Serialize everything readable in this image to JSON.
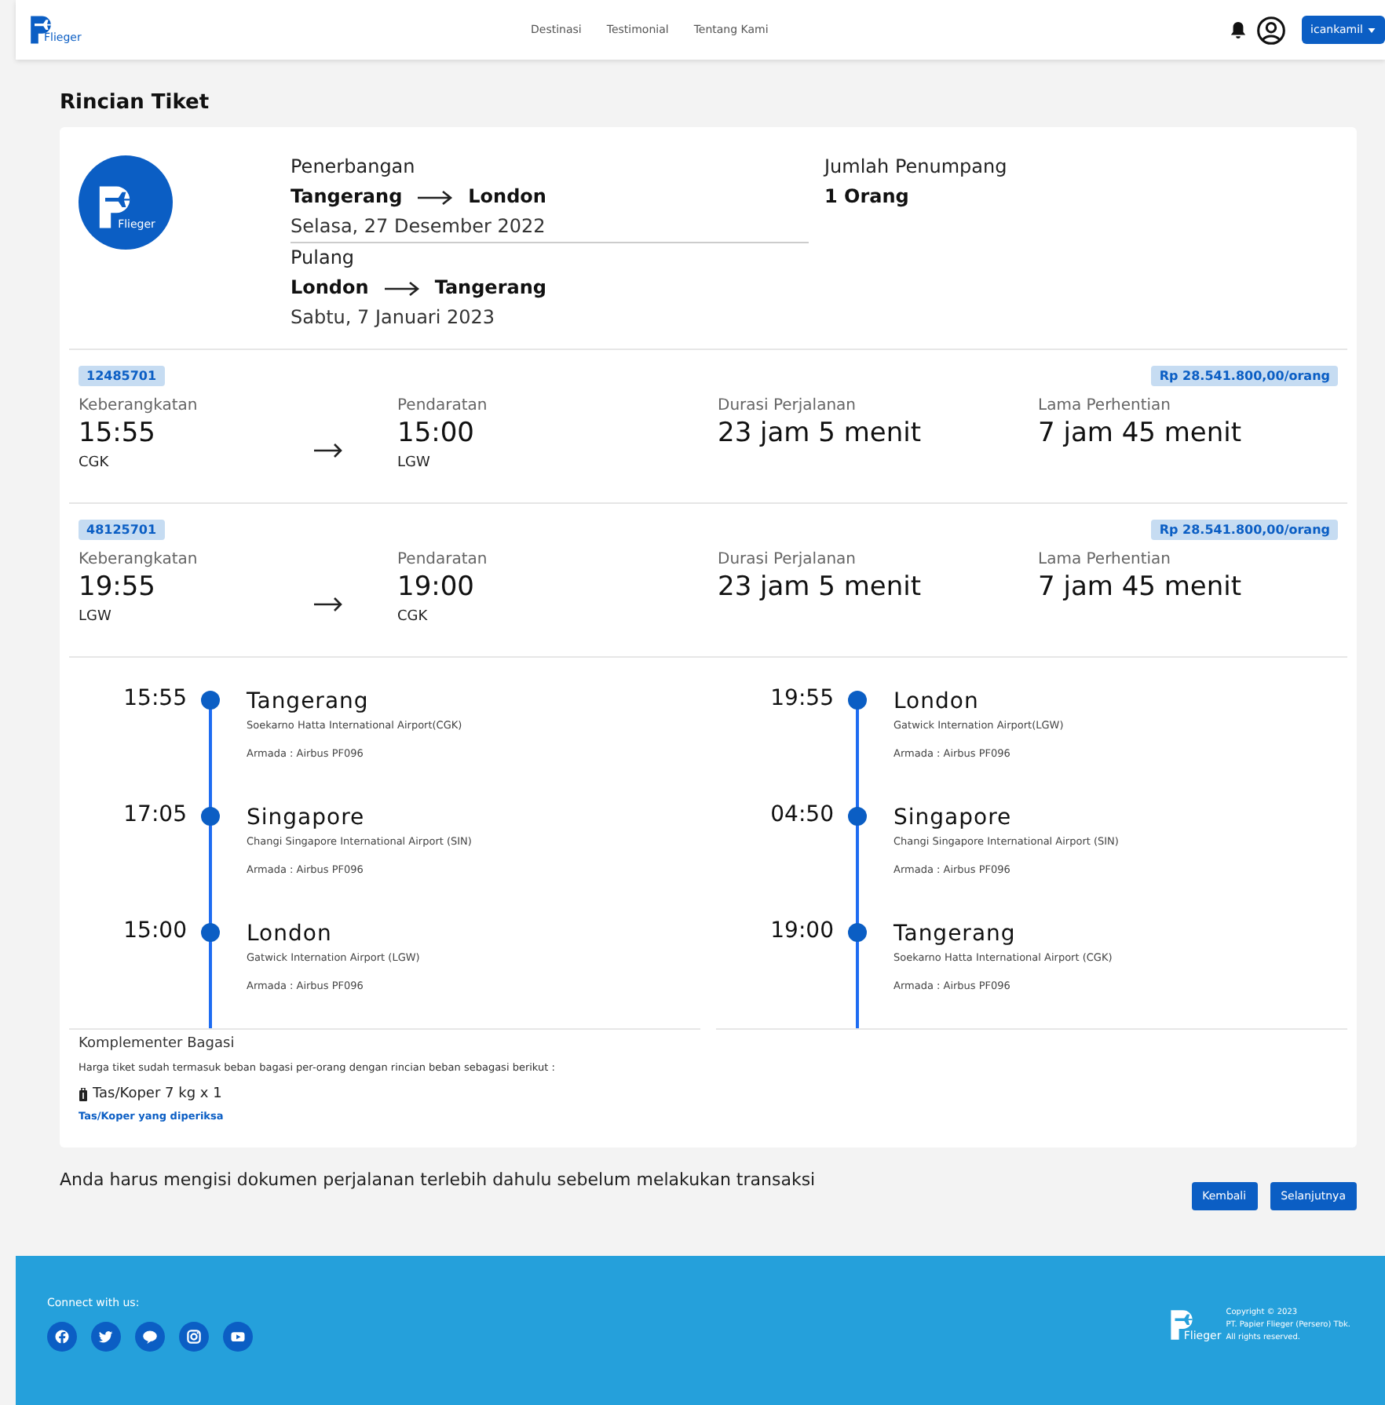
{
  "navbar": {
    "logo_text": "Flieger",
    "links": [
      "Destinasi",
      "Testimonial",
      "Tentang Kami"
    ],
    "user_button": "icankamil"
  },
  "page_title": "Rincian Tiket",
  "summary": {
    "logo_text": "Flieger",
    "legs": [
      {
        "label": "Penerbangan",
        "from": "Tangerang",
        "to": "London",
        "date": "Selasa, 27 Desember 2022"
      },
      {
        "label": "Pulang",
        "from": "London",
        "to": "Tangerang",
        "date": "Sabtu, 7 Januari 2023"
      }
    ],
    "passengers": {
      "label": "Jumlah Penumpang",
      "value": "1 Orang"
    }
  },
  "segments": [
    {
      "code": "12485701",
      "price": "Rp 28.541.800,00/orang",
      "departure": {
        "label": "Keberangkatan",
        "time": "15:55",
        "airport": "CGK"
      },
      "arrival": {
        "label": "Pendaratan",
        "time": "15:00",
        "airport": "LGW"
      },
      "duration": {
        "label": "Durasi Perjalanan",
        "value": "23 jam 5 menit"
      },
      "stopover": {
        "label": "Lama Perhentian",
        "value": "7 jam 45 menit"
      }
    },
    {
      "code": "48125701",
      "price": "Rp 28.541.800,00/orang",
      "departure": {
        "label": "Keberangkatan",
        "time": "19:55",
        "airport": "LGW"
      },
      "arrival": {
        "label": "Pendaratan",
        "time": "19:00",
        "airport": "CGK"
      },
      "duration": {
        "label": "Durasi Perjalanan",
        "value": "23 jam 5 menit"
      },
      "stopover": {
        "label": "Lama Perhentian",
        "value": "7 jam 45 menit"
      }
    }
  ],
  "itineraries": [
    [
      {
        "time": "15:55",
        "city": "Tangerang",
        "airport": "Soekarno Hatta International Airport(CGK)",
        "fleet": "Armada : Airbus PF096"
      },
      {
        "time": "17:05",
        "city": "Singapore",
        "airport": "Changi Singapore International Airport (SIN)",
        "fleet": "Armada : Airbus PF096"
      },
      {
        "time": "15:00",
        "city": "London",
        "airport": "Gatwick Internation Airport (LGW)",
        "fleet": "Armada : Airbus PF096"
      }
    ],
    [
      {
        "time": "19:55",
        "city": "London",
        "airport": "Gatwick Internation Airport(LGW)",
        "fleet": "Armada : Airbus PF096"
      },
      {
        "time": "04:50",
        "city": "Singapore",
        "airport": "Changi Singapore International Airport (SIN)",
        "fleet": "Armada : Airbus PF096"
      },
      {
        "time": "19:00",
        "city": "Tangerang",
        "airport": "Soekarno Hatta International Airport (CGK)",
        "fleet": "Armada : Airbus PF096"
      }
    ]
  ],
  "baggage": {
    "title": "Komplementer Bagasi",
    "description": "Harga tiket sudah termasuk beban bagasi per-orang dengan rincian beban sebagasi berikut :",
    "item": "Tas/Koper 7 kg x 1",
    "link": "Tas/Koper yang diperiksa"
  },
  "notice": "Anda harus mengisi dokumen perjalanan terlebih dahulu sebelum melakukan transaksi",
  "buttons": [
    "Kembali",
    "Selanjutnya"
  ],
  "footer": {
    "connect_label": "Connect with us:",
    "logo_text": "Flieger",
    "copyright": [
      "Copyright © 2023",
      "PT. Papier Flieger (Persero) Tbk.",
      "All rights reserved."
    ]
  }
}
